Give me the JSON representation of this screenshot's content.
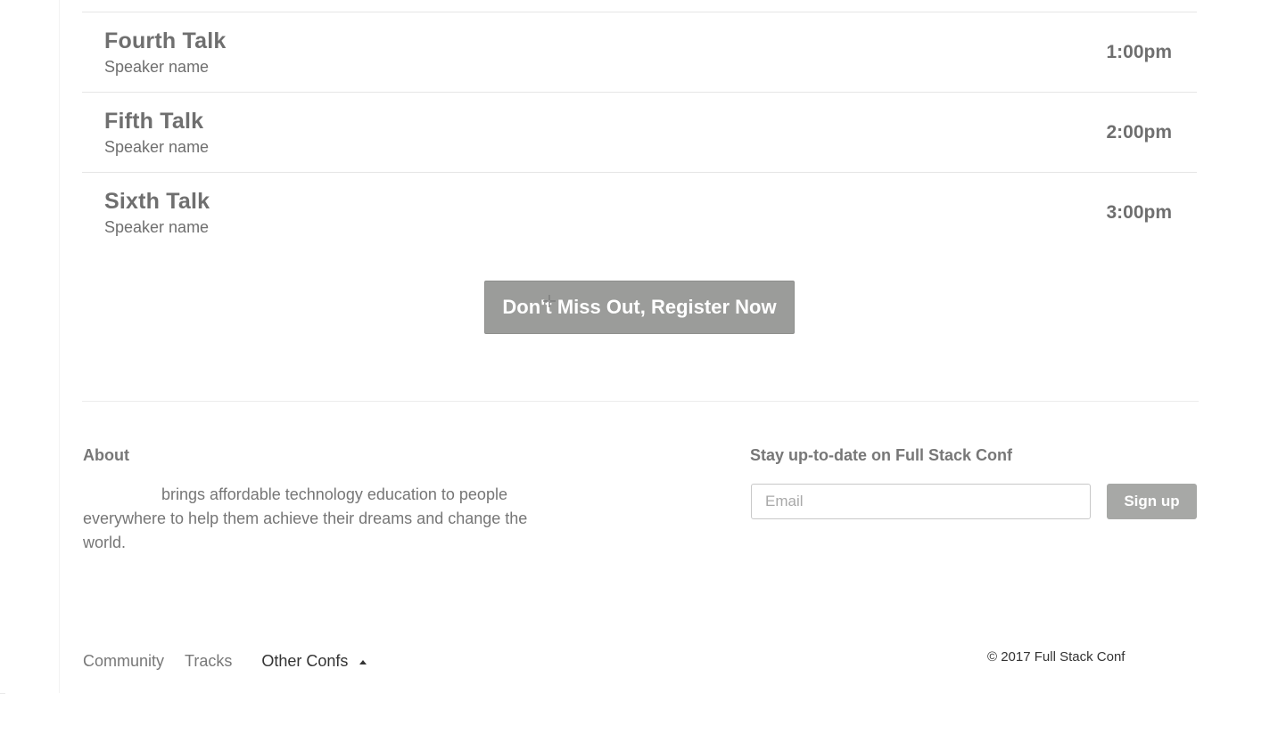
{
  "schedule": {
    "talks": [
      {
        "title": "Fourth Talk",
        "speaker": "Speaker name",
        "time": "1:00pm"
      },
      {
        "title": "Fifth Talk",
        "speaker": "Speaker name",
        "time": "2:00pm"
      },
      {
        "title": "Sixth Talk",
        "speaker": "Speaker name",
        "time": "3:00pm"
      }
    ]
  },
  "cta": {
    "register_label": "Don't Miss Out, Register Now"
  },
  "footer": {
    "about_heading": "About",
    "about_text": "brings affordable technology education to people everywhere to help them achieve their dreams and change the world.",
    "newsletter_heading": "Stay up-to-date on Full Stack Conf",
    "email_placeholder": "Email",
    "signup_label": "Sign up",
    "nav": {
      "community": "Community",
      "tracks": "Tracks",
      "other_confs": "Other Confs"
    },
    "copyright": "© 2017 Full Stack Conf"
  },
  "icons": {
    "cursor": "crosshair-cursor-icon",
    "dropdown": "caret-up-icon"
  }
}
